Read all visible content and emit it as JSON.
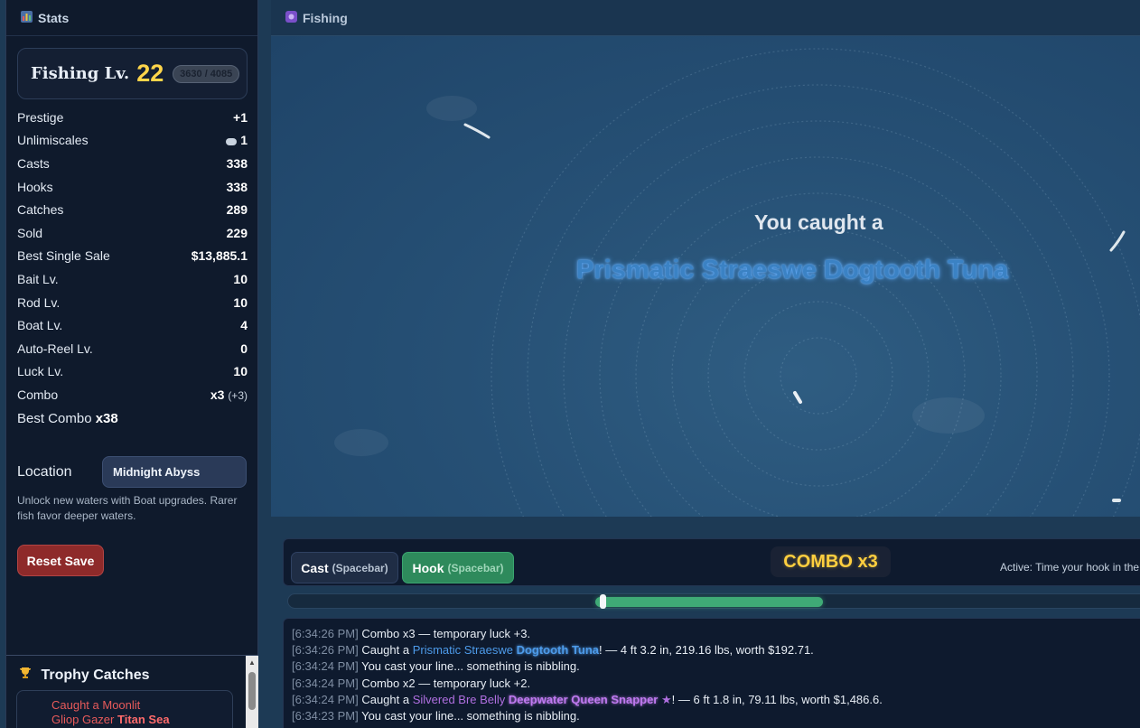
{
  "stats_panel": {
    "title": "Stats",
    "title_icon": "bar-chart-icon",
    "level_label": "Fishing Lv.",
    "level": "22",
    "xp_text": "3630 / 4085",
    "rows": [
      {
        "key": "Prestige",
        "value": "+1"
      },
      {
        "key": "Unlimiscales",
        "value": "1",
        "icon": "scale-icon"
      },
      {
        "key": "Casts",
        "value": "338"
      },
      {
        "key": "Hooks",
        "value": "338"
      },
      {
        "key": "Catches",
        "value": "289"
      },
      {
        "key": "Sold",
        "value": "229"
      },
      {
        "key": "Best Single Sale",
        "value": "$13,885.1"
      },
      {
        "key": "Bait Lv.",
        "value": "10"
      },
      {
        "key": "Rod Lv.",
        "value": "10"
      },
      {
        "key": "Boat Lv.",
        "value": "4"
      },
      {
        "key": "Auto-Reel Lv.",
        "value": "0"
      },
      {
        "key": "Luck Lv.",
        "value": "10"
      },
      {
        "key": "Combo",
        "value": "x3",
        "extra": "(+3)"
      }
    ],
    "best_combo_label": "Best Combo",
    "best_combo_value": "x38",
    "location_label": "Location",
    "location_value": "Midnight Abyss",
    "location_hint": "Unlock new waters with Boat upgrades. Rarer fish favor deeper waters.",
    "reset_label": "Reset Save"
  },
  "trophy": {
    "title": "Trophy Catches",
    "icon": "trophy-icon",
    "entry_prefix": "Caught a Moonlit",
    "entry_rest": "Gliop Gazer",
    "entry_bold": "Titan Sea"
  },
  "fishing": {
    "title": "Fishing",
    "title_icon": "fishing-icon",
    "caught_label": "You caught a",
    "caught_fish": "Prismatic Straeswe Dogtooth Tuna"
  },
  "controls": {
    "cast_label": "Cast",
    "cast_key": "(Spacebar)",
    "hook_label": "Hook",
    "hook_key": "(Spacebar)",
    "combo_badge": "COMBO x3",
    "active_hint": "Active: Time your hook in the"
  },
  "colors": {
    "accent_gold": "#ffd54a",
    "hook_green": "#2e8a5c",
    "reset_red": "#8e2a2a",
    "rare_blue": "#4d9bea",
    "epic_purple": "#b06fe0"
  },
  "log": [
    {
      "ts": "[6:34:26 PM]",
      "parts": [
        {
          "t": "Combo x3 — temporary luck +3.",
          "c": ""
        }
      ]
    },
    {
      "ts": "[6:34:26 PM]",
      "parts": [
        {
          "t": "Caught a ",
          "c": ""
        },
        {
          "t": "Prismatic Straeswe ",
          "c": "fish-blue"
        },
        {
          "t": "Dogtooth Tuna",
          "c": "fish-blue-b"
        },
        {
          "t": "! — 4 ft 3.2 in, 219.16 lbs, worth $192.71.",
          "c": ""
        }
      ]
    },
    {
      "ts": "[6:34:24 PM]",
      "parts": [
        {
          "t": "You cast your line... something is nibbling.",
          "c": ""
        }
      ]
    },
    {
      "ts": "[6:34:24 PM]",
      "parts": [
        {
          "t": "Combo x2 — temporary luck +2.",
          "c": ""
        }
      ]
    },
    {
      "ts": "[6:34:24 PM]",
      "parts": [
        {
          "t": "Caught a ",
          "c": ""
        },
        {
          "t": "Silvered Bre Belly ",
          "c": "fish-purple"
        },
        {
          "t": "Deepwater Queen Snapper",
          "c": "fish-purple-b"
        },
        {
          "t": "  ★",
          "c": "star"
        },
        {
          "t": "! — 6 ft 1.8 in, 79.11 lbs, worth $1,486.6.",
          "c": ""
        }
      ]
    },
    {
      "ts": "[6:34:23 PM]",
      "parts": [
        {
          "t": "You cast your line... something is nibbling.",
          "c": ""
        }
      ]
    }
  ]
}
